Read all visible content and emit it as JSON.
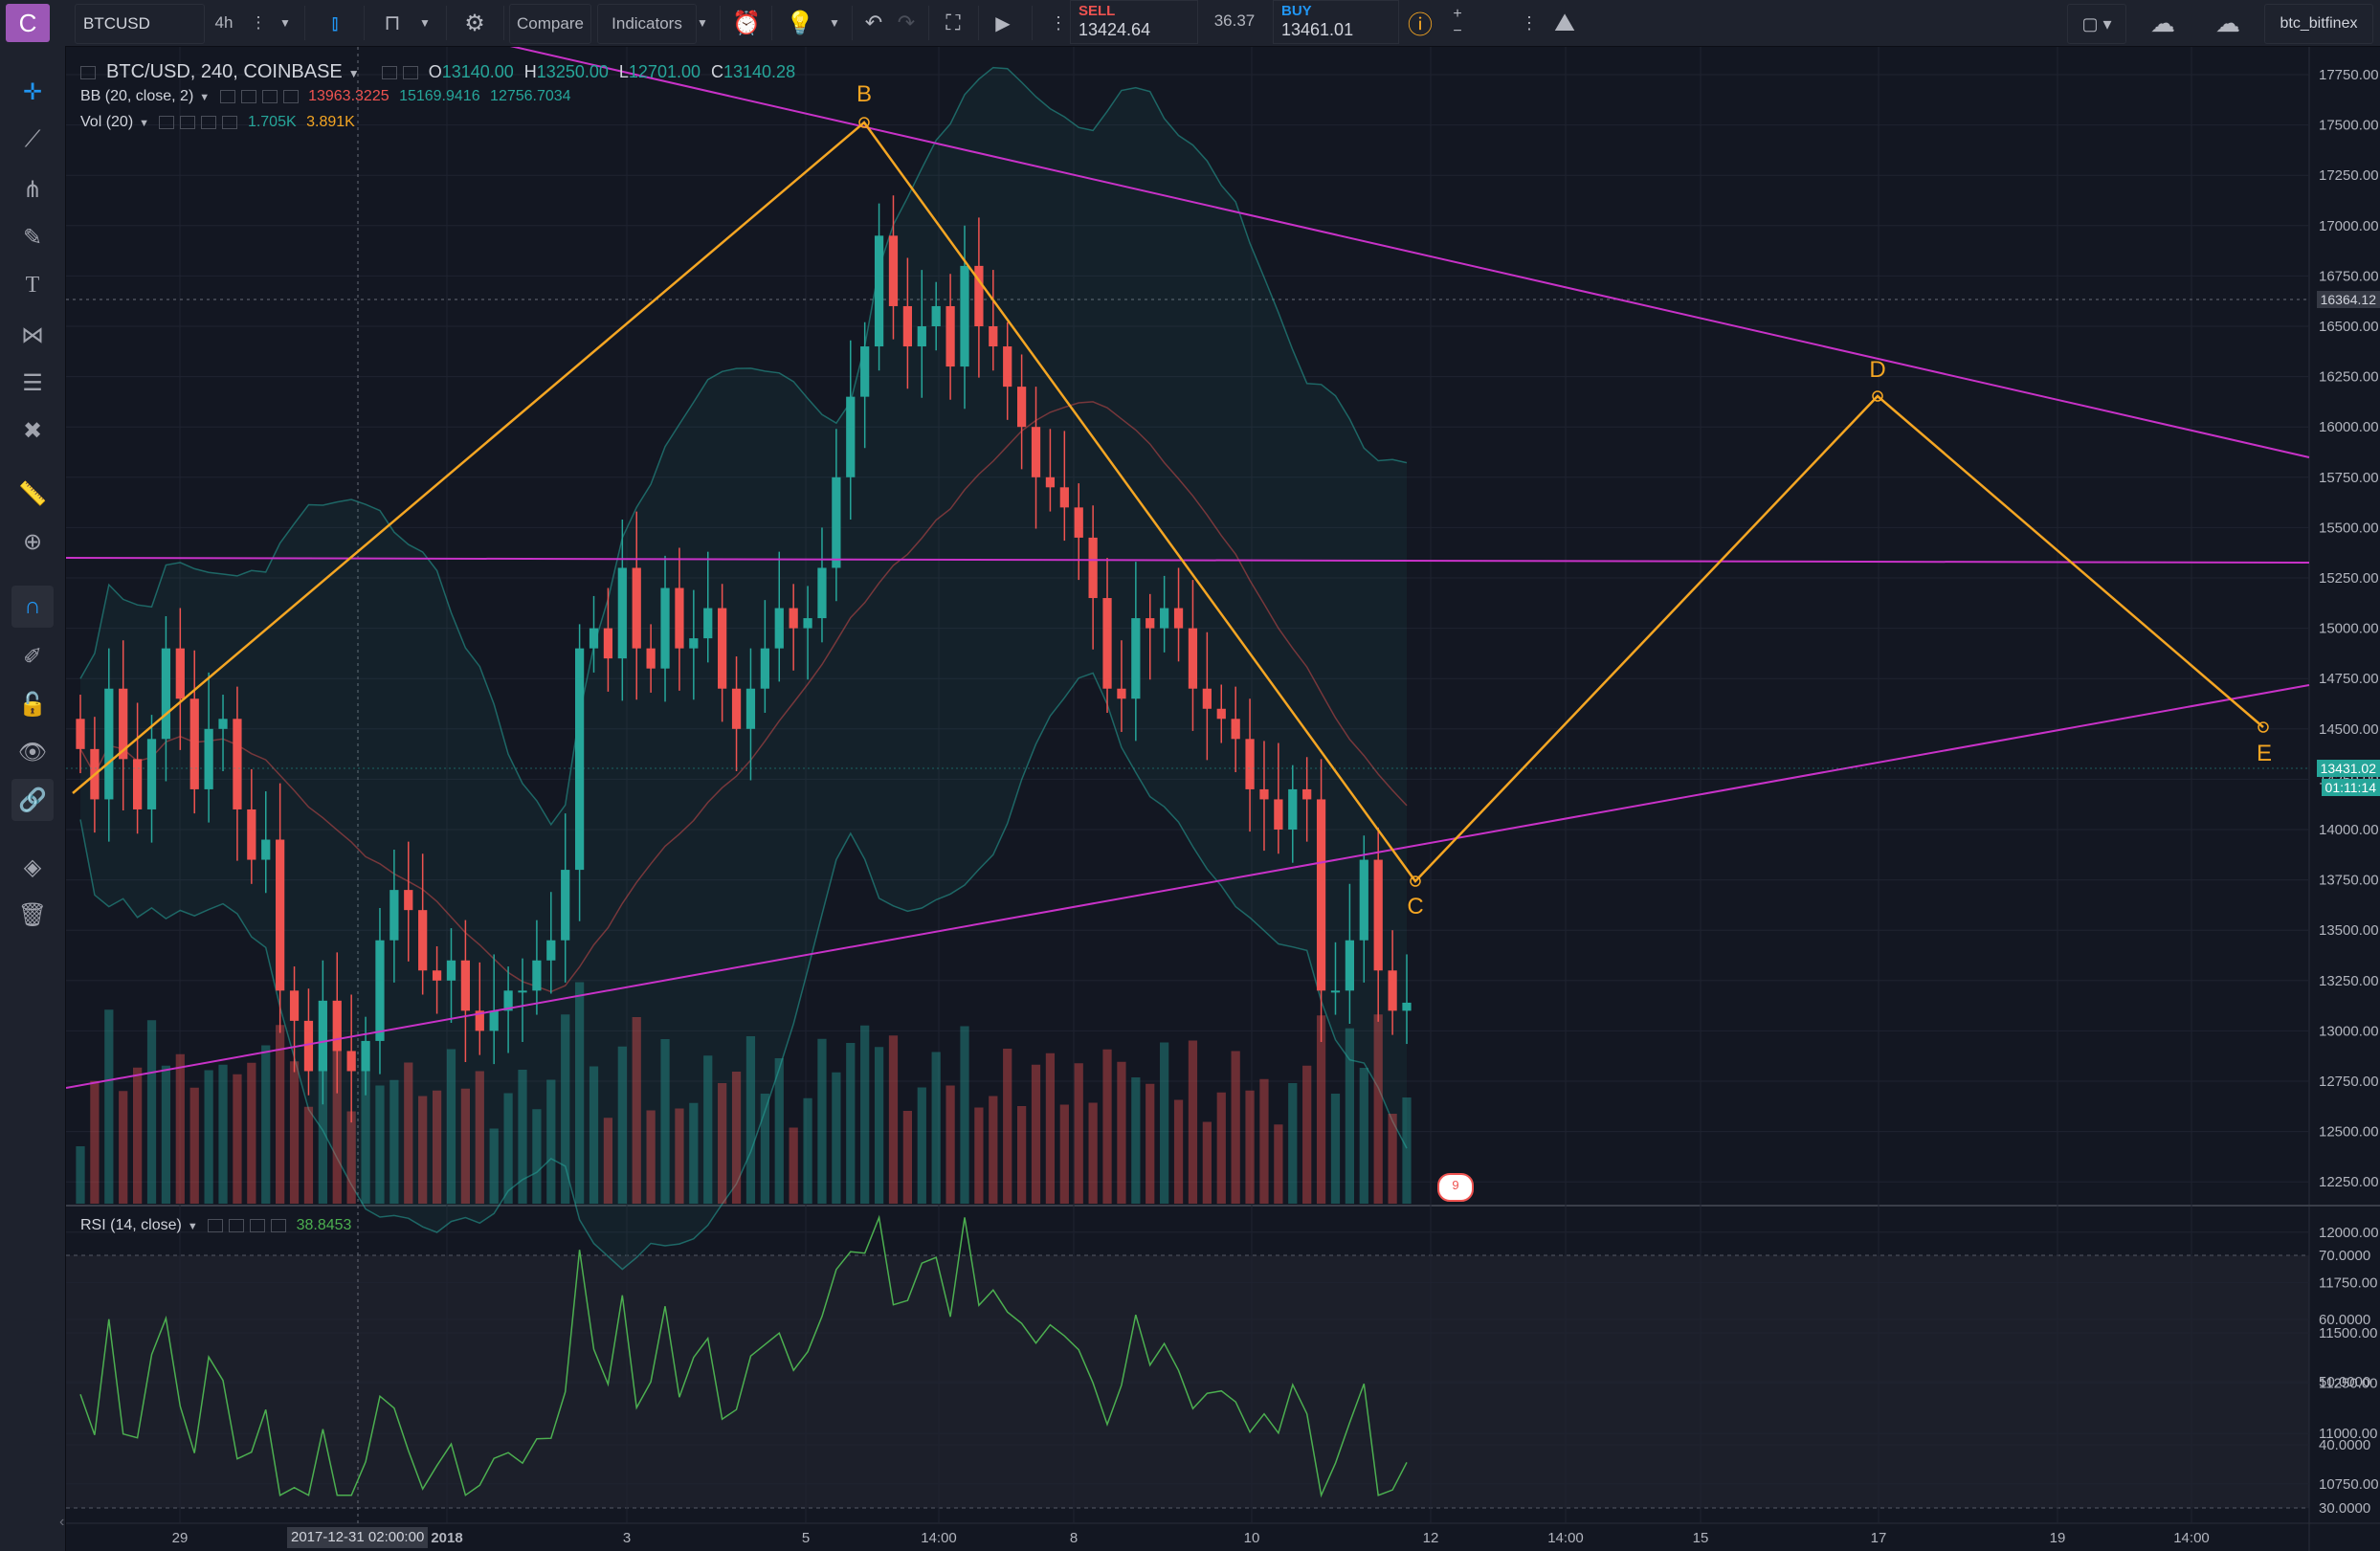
{
  "topbar": {
    "logo": "C",
    "symbol": "BTCUSD",
    "interval": "4h",
    "compare": "Compare",
    "indicators": "Indicators",
    "sell_label": "SELL",
    "sell_price": "13424.64",
    "spread": "36.37",
    "buy_label": "BUY",
    "buy_price": "13461.01",
    "account": "btc_bitfinex"
  },
  "legend": {
    "main_symbol": "BTC/USD, 240, COINBASE",
    "o_label": "O",
    "o_val": "13140.00",
    "h_label": "H",
    "h_val": "13250.00",
    "l_label": "L",
    "l_val": "12701.00",
    "c_label": "C",
    "c_val": "13140.28",
    "bb_name": "BB (20, close, 2)",
    "bb_mid": "13963.3225",
    "bb_up": "15169.9416",
    "bb_low": "12756.7034",
    "vol_name": "Vol (20)",
    "vol_v1": "1.705K",
    "vol_v2": "3.891K",
    "rsi_name": "RSI (14, close)",
    "rsi_val": "38.8453"
  },
  "price_axis": {
    "labels": [
      "17750.00",
      "17500.00",
      "17250.00",
      "17000.00",
      "16750.00",
      "16500.00",
      "16250.00",
      "16000.00",
      "15750.00",
      "15500.00",
      "15250.00",
      "15000.00",
      "14750.00",
      "14500.00",
      "14250.00",
      "14000.00",
      "13750.00",
      "13500.00",
      "13250.00",
      "13000.00",
      "12750.00",
      "12500.00",
      "12250.00",
      "12000.00",
      "11750.00",
      "11500.00",
      "11250.00",
      "11000.00",
      "10750.00"
    ],
    "crosshair_price": "16364.12",
    "last_price": "13431.02",
    "countdown": "01:11:14"
  },
  "rsi_axis": {
    "labels": [
      "70.0000",
      "60.0000",
      "50.0000",
      "40.0000",
      "30.0000"
    ]
  },
  "time_axis": {
    "labels": [
      "29",
      "2018",
      "3",
      "5",
      "14:00",
      "8",
      "10",
      "12",
      "14:00",
      "15",
      "17",
      "19",
      "14:00"
    ],
    "crosshair_time": "2017-12-31 02:00:00"
  },
  "pattern": {
    "points": [
      "B",
      "C",
      "D",
      "E"
    ]
  },
  "event_badge": "9",
  "colors": {
    "up": "#26a69a",
    "down": "#ef5350",
    "pattern": "#f5a623",
    "trend": "#c832c8",
    "bg": "#131722",
    "panel": "#1e222d",
    "rsi": "#4caf50"
  }
}
